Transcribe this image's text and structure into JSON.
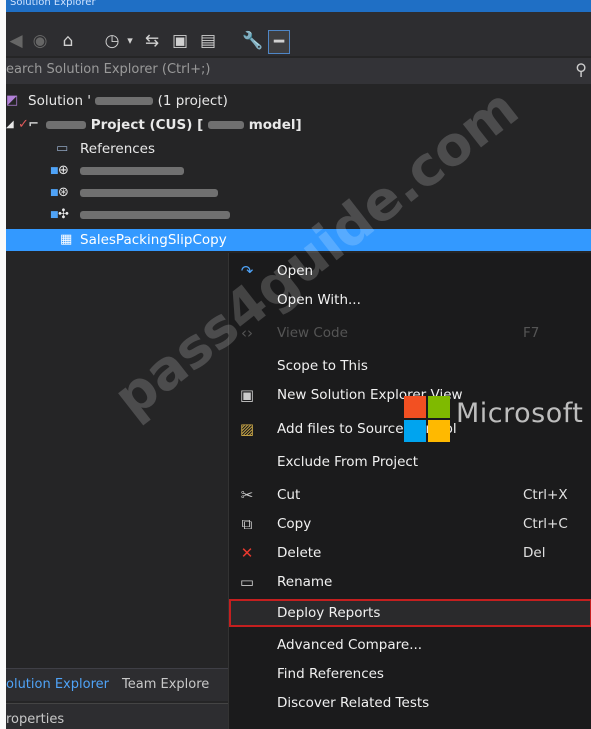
{
  "window": {
    "title": "Solution Explorer"
  },
  "search": {
    "placeholder": "earch Solution Explorer (Ctrl+;)"
  },
  "toolbar": {
    "icons": [
      "back-icon",
      "forward-icon",
      "home-icon",
      "history-icon",
      "sync-icon",
      "collapse-all-icon",
      "show-all-files-icon",
      "properties-icon",
      "preview-icon"
    ]
  },
  "tree": {
    "solution": {
      "prefix": "Solution '",
      "suffix": "(1 project)"
    },
    "project": {
      "prefix": "Project (CUS) [",
      "suffix": "model]"
    },
    "references": "References",
    "selected_item": "SalesPackingSlipCopy"
  },
  "menu": {
    "items": [
      {
        "label": "Open",
        "shortcut": ""
      },
      {
        "label": "Open With...",
        "shortcut": ""
      },
      {
        "label": "View Code",
        "shortcut": "F7"
      },
      {
        "label": "Scope to This",
        "shortcut": ""
      },
      {
        "label": "New Solution Explorer View",
        "shortcut": ""
      },
      {
        "label": "Add files to Source Control",
        "shortcut": ""
      },
      {
        "label": "Exclude From Project",
        "shortcut": ""
      },
      {
        "label": "Cut",
        "shortcut": "Ctrl+X"
      },
      {
        "label": "Copy",
        "shortcut": "Ctrl+C"
      },
      {
        "label": "Delete",
        "shortcut": "Del"
      },
      {
        "label": "Rename",
        "shortcut": ""
      },
      {
        "label": "Deploy Reports",
        "shortcut": ""
      },
      {
        "label": "Advanced Compare...",
        "shortcut": ""
      },
      {
        "label": "Find References",
        "shortcut": ""
      },
      {
        "label": "Discover Related Tests",
        "shortcut": ""
      }
    ]
  },
  "tabs": {
    "solution_explorer": "olution Explorer",
    "team_explorer": "Team Explore"
  },
  "properties": "roperties",
  "overlay": {
    "logo_text": "Microsoft",
    "watermark": "pass4guide.com"
  },
  "colors": {
    "selection": "#3399ff",
    "highlight_box": "#c41f1f",
    "background": "#252526"
  }
}
